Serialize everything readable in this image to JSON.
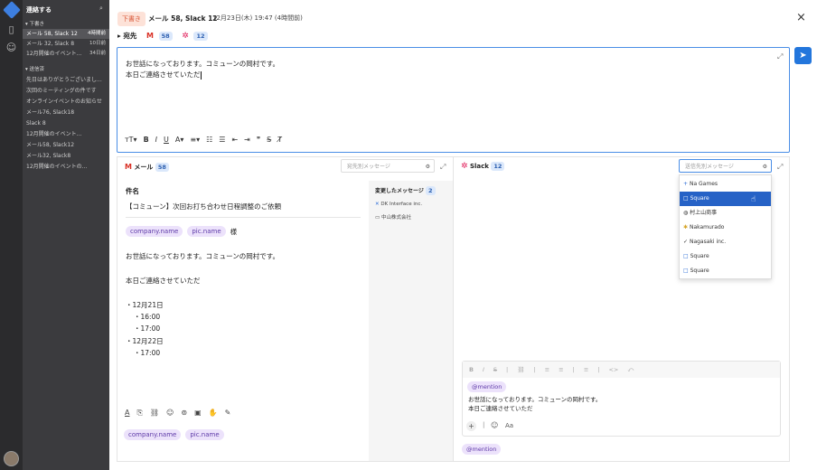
{
  "sidebar": {
    "title": "連絡する",
    "drafts_label": "▾ 下書き",
    "sent_label": "▾ 送信済",
    "drafts": [
      {
        "label": "メール 58, Slack 12",
        "time": "4時間前"
      },
      {
        "label": "メール 32, Slack 8",
        "time": "10日前"
      },
      {
        "label": "12月開催のイベント...",
        "time": "34日前"
      }
    ],
    "sent": [
      {
        "label": "先日はありがとうございまし..."
      },
      {
        "label": "次回のミーティングの件です"
      },
      {
        "label": "オンラインイベントのお知らせ"
      },
      {
        "label": "メール76, Slack18"
      },
      {
        "label": "Slack 8"
      },
      {
        "label": "12月開催のイベント..."
      },
      {
        "label": "メール58, Slack12"
      },
      {
        "label": "メール32, Slack8"
      },
      {
        "label": "12月開催のイベントの..."
      }
    ]
  },
  "header": {
    "status_tag": "下書き",
    "title": "メール 58, Slack 12",
    "date": "12月23日(木) 19:47 (4時間前)",
    "close": "×"
  },
  "recipients": {
    "label": "▸ 宛先",
    "gmail_icon": "M",
    "mail_count": "58",
    "slack_count": "12"
  },
  "editor": {
    "line1": "お世話になっております。コミューンの岡村です。",
    "line2": "本日ご連絡させていただ"
  },
  "toolbar": [
    "тT▾",
    "B",
    "I",
    "U",
    "A▾",
    "≡▾",
    "☷",
    "☰",
    "⇤",
    "⇥",
    "❞",
    "S̶",
    "T̸"
  ],
  "mail_pane": {
    "title": "メール",
    "count": "58",
    "filter_placeholder": "宛先別メッセージ",
    "subject_label": "件名",
    "subject": "【コミューン】次回お打ち合わせ日程調整のご依頼",
    "chip1": "company.name",
    "chip2": "pic.name",
    "honorific": "様",
    "body1": "お世話になっております。コミューンの岡村です。",
    "body2": "本日ご連絡させていただ",
    "schedule": [
      "・12月21日",
      "・16:00",
      "・17:00",
      "・12月22日",
      "・17:00"
    ],
    "bottom_icons": [
      "A",
      "⎘",
      "⛓",
      "☺",
      "⊚",
      "▣",
      "✋",
      "✎"
    ],
    "footer_chip1": "company.name",
    "footer_chip2": "pic.name"
  },
  "changed": {
    "title": "変更したメッセージ",
    "count": "2",
    "items": [
      {
        "icon": "✕",
        "label": "DK Interface inc."
      },
      {
        "icon": "▭",
        "label": "中山株式会社"
      }
    ]
  },
  "slack_pane": {
    "title": "Slack",
    "count": "12",
    "filter_placeholder": "送信先別メッセージ",
    "dropdown": [
      {
        "icon": "+",
        "label": "Na Games"
      },
      {
        "icon": "□",
        "label": "Square",
        "selected": true
      },
      {
        "icon": "◍",
        "label": "村上山商事"
      },
      {
        "icon": "✱",
        "label": "Nakamurado"
      },
      {
        "icon": "✓",
        "label": "Nagasaki inc."
      },
      {
        "icon": "□",
        "label": "Square"
      },
      {
        "icon": "□",
        "label": "Square"
      }
    ],
    "composer_toolbar": [
      "B",
      "I",
      "S",
      "|",
      "⛓",
      "|",
      "≡",
      "≡",
      "|",
      "≡",
      "|",
      "<>",
      "⤺"
    ],
    "mention": "@mention",
    "line1": "お世話になっております。コミューンの岡村です。",
    "line2": "本日ご連絡させていただ",
    "plus": "+",
    "emoji": "☺",
    "aa": "Aa",
    "footer_mention": "@mention"
  },
  "colors": {
    "accent": "#2376dc",
    "sidebar": "#3b3b3e",
    "draft_tag": "#d9593a",
    "chip": "#ece2fb"
  }
}
